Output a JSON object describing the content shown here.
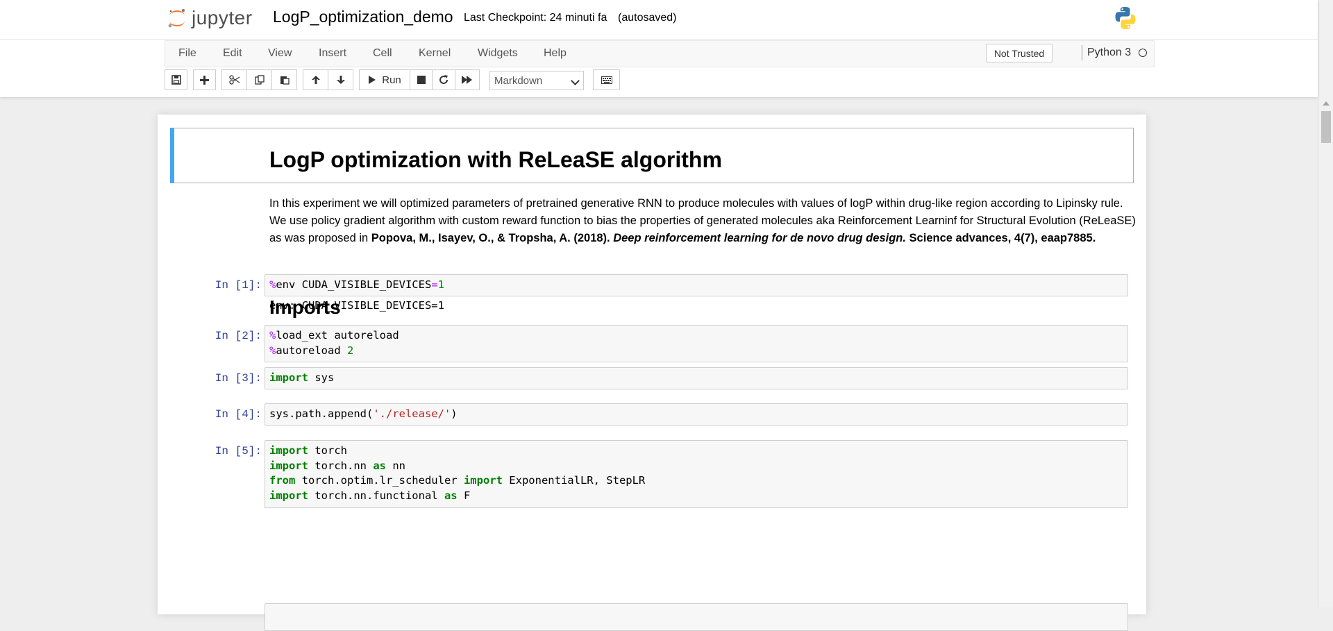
{
  "header": {
    "logo_text": "jupyter",
    "notebook_name": "LogP_optimization_demo",
    "checkpoint": "Last Checkpoint: 24 minuti fa",
    "autosave": "(autosaved)"
  },
  "menu": {
    "items": [
      "File",
      "Edit",
      "View",
      "Insert",
      "Cell",
      "Kernel",
      "Widgets",
      "Help"
    ],
    "trust": "Not Trusted",
    "kernel": "Python 3"
  },
  "toolbar": {
    "run_label": "Run",
    "cell_type": "Markdown",
    "icons": [
      "save-icon",
      "plus-icon",
      "cut-icon",
      "copy-icon",
      "paste-icon",
      "arrow-up-icon",
      "arrow-down-icon",
      "run-icon",
      "stop-icon",
      "restart-icon",
      "fast-forward-icon",
      "keyboard-icon"
    ]
  },
  "notebook": {
    "title": "LogP optimization with ReLeaSE algorithm",
    "intro": "In this experiment we will optimized parameters of pretrained generative RNN to produce molecules with values of logP within drug-like region according to Lipinsky rule. We use policy gradient algorithm with custom reward function to bias the properties of generated molecules aka Reinforcement Learninf for Structural Evolution (ReLeaSE) as was proposed in ",
    "citation_authors": "Popova, M., Isayev, O., & Tropsha, A. (2018).",
    "citation_title": "Deep reinforcement learning for de novo drug design.",
    "citation_journal": "Science advances, 4(7), eaap7885.",
    "section_title": "Imports",
    "cells": [
      {
        "prompt": "In [1]:",
        "output": "env: CUDA_VISIBLE_DEVICES=1"
      },
      {
        "prompt": "In [2]:"
      },
      {
        "prompt": "In [3]:"
      },
      {
        "prompt": "In [4]:"
      },
      {
        "prompt": "In [5]:"
      }
    ]
  },
  "colors": {
    "prompt": "#303f9f",
    "selected_border": "#42a5f5",
    "keyword": "#008000",
    "magic": "#aa22ff",
    "string": "#ba2121"
  }
}
